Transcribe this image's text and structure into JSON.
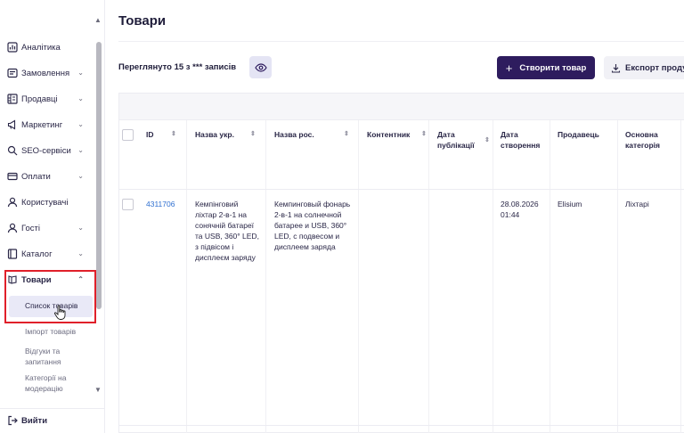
{
  "sidebar": {
    "items": [
      {
        "label": "Аналітика",
        "icon": "chart-icon",
        "has_chevron": false
      },
      {
        "label": "Замовлення",
        "icon": "orders-icon",
        "has_chevron": true
      },
      {
        "label": "Продавці",
        "icon": "store-icon",
        "has_chevron": true
      },
      {
        "label": "Маркетинг",
        "icon": "megaphone-icon",
        "has_chevron": true
      },
      {
        "label": "SEO-сервіси",
        "icon": "seo-icon",
        "has_chevron": true
      },
      {
        "label": "Оплати",
        "icon": "card-icon",
        "has_chevron": true
      },
      {
        "label": "Користувачі",
        "icon": "user-icon",
        "has_chevron": false
      },
      {
        "label": "Гості",
        "icon": "guest-icon",
        "has_chevron": true
      },
      {
        "label": "Каталог",
        "icon": "catalog-icon",
        "has_chevron": true
      },
      {
        "label": "Товари",
        "icon": "products-icon",
        "has_chevron": true,
        "expanded": true
      }
    ],
    "sub_items": [
      {
        "label": "Список товарів",
        "active": true
      },
      {
        "label": "Імпорт товарів"
      },
      {
        "label": "Відгуки та запитання"
      },
      {
        "label": "Категорії на модерацію"
      }
    ],
    "logout_label": "Вийти"
  },
  "main": {
    "title": "Товари",
    "viewed_text": "Переглянуто 15 з *** записів",
    "create_button": "Створити товар",
    "export_button": "Експорт продукції"
  },
  "table": {
    "columns": [
      {
        "label": "ID",
        "sortable": true
      },
      {
        "label": "Назва укр.",
        "sortable": true
      },
      {
        "label": "Назва рос.",
        "sortable": true
      },
      {
        "label": "Контентник",
        "sortable": true
      },
      {
        "label": "Дата публікації",
        "sortable": true
      },
      {
        "label": "Дата створення",
        "sortable": false
      },
      {
        "label": "Продавець",
        "sortable": false
      },
      {
        "label": "Основна категорія",
        "sortable": false
      }
    ],
    "rows": [
      {
        "id": "4311706",
        "name_ukr": "Кемпінговий ліхтар 2-в-1 на сонячній батареї та USB, 360° LED, з підвісом і дисплеєм заряду",
        "name_rus": "Кемпинговый фонарь 2-в-1 на солнечной батарее и USB, 360° LED, с подвесом и дисплеем заряда",
        "content_manager": "",
        "published": "",
        "created": "28.08.2026 01:44",
        "seller": "Elisium",
        "category": "Ліхтарі"
      }
    ]
  },
  "colors": {
    "accent": "#2e1c5e",
    "highlight": "#e0202a",
    "link": "#2f6fd0"
  }
}
